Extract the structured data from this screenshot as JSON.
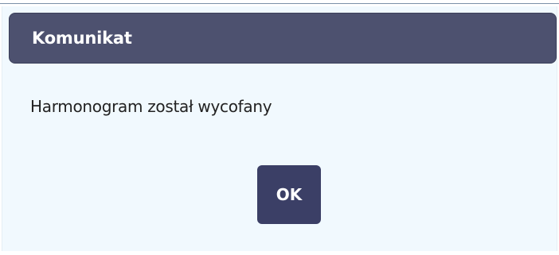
{
  "dialog": {
    "title": "Komunikat",
    "message": "Harmonogram został wycofany",
    "ok_label": "OK"
  },
  "colors": {
    "header_bg": "#4d516f",
    "dialog_bg": "#f1f9fe",
    "button_bg": "#3b3f66",
    "text": "#222222"
  }
}
